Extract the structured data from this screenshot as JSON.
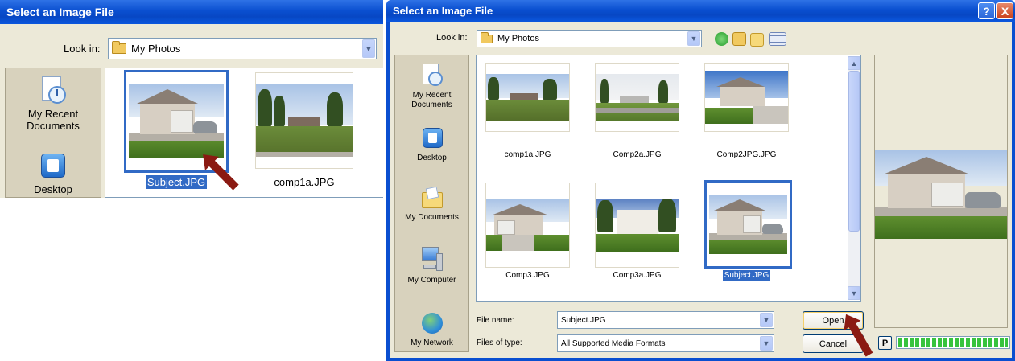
{
  "left_dialog": {
    "title": "Select an Image File",
    "look_in_label": "Look in:",
    "look_in_value": "My Photos",
    "places": [
      {
        "label": "My Recent Documents",
        "icon": "recent-documents-icon"
      },
      {
        "label": "Desktop",
        "icon": "desktop-icon"
      }
    ],
    "files": [
      {
        "name": "Subject.JPG",
        "selected": true
      },
      {
        "name": "comp1a.JPG",
        "selected": false
      }
    ]
  },
  "right_dialog": {
    "title": "Select an Image File",
    "caption_help": "?",
    "caption_close": "X",
    "look_in_label": "Look in:",
    "look_in_value": "My Photos",
    "places": [
      {
        "label": "My Recent Documents",
        "icon": "recent-documents-icon"
      },
      {
        "label": "Desktop",
        "icon": "desktop-icon"
      },
      {
        "label": "My Documents",
        "icon": "my-documents-icon"
      },
      {
        "label": "My Computer",
        "icon": "my-computer-icon"
      },
      {
        "label": "My Network",
        "icon": "network-icon"
      }
    ],
    "files": [
      {
        "name": "comp1a.JPG",
        "selected": false
      },
      {
        "name": "Comp2a.JPG",
        "selected": false
      },
      {
        "name": "Comp2JPG.JPG",
        "selected": false
      },
      {
        "name": "Comp3.JPG",
        "selected": false
      },
      {
        "name": "Comp3a.JPG",
        "selected": false
      },
      {
        "name": "Subject.JPG",
        "selected": true
      }
    ],
    "file_name_label": "File name:",
    "file_name_value": "Subject.JPG",
    "files_of_type_label": "Files of type:",
    "files_of_type_value": "All Supported Media Formats",
    "open_button": "Open",
    "cancel_button": "Cancel",
    "preview_toggle": "P",
    "progress_fraction": 1.0
  },
  "colors": {
    "titlebar": "#0a4fd0",
    "selection": "#316ac5",
    "dialog_face": "#ece9d8",
    "arrow": "#8b1a12"
  }
}
